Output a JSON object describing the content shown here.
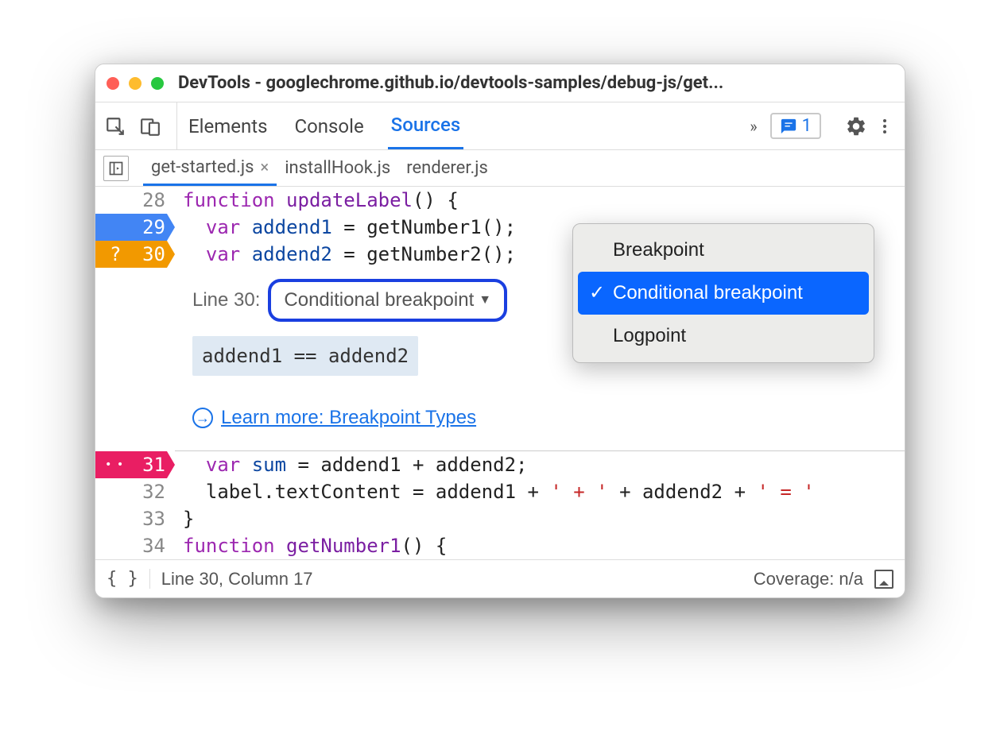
{
  "window_title": "DevTools - googlechrome.github.io/devtools-samples/debug-js/get...",
  "toolbar_tabs": {
    "elements": "Elements",
    "console": "Console",
    "sources": "Sources"
  },
  "issues_count": "1",
  "file_tabs": {
    "active": "get-started.js",
    "second": "installHook.js",
    "third": "renderer.js"
  },
  "code": {
    "l28_num": "28",
    "l28": {
      "kw": "function",
      "fn": " updateLabel",
      "rest": "() {"
    },
    "l29_num": "29",
    "l29": {
      "indent": "  ",
      "kw": "var",
      "id": " addend1",
      "rest": " = getNumber1();"
    },
    "l30_num": "30",
    "l30": {
      "indent": "  ",
      "kw": "var",
      "id": " addend2",
      "rest": " = getNumber2();"
    },
    "l31_num": "31",
    "l31": {
      "indent": "  ",
      "kw": "var",
      "id": " sum",
      "rest": " = addend1 + addend2;"
    },
    "l32_num": "32",
    "l32": {
      "indent": "  label.textContent = addend1 + ",
      "s1": "' + '",
      "mid": " + addend2 + ",
      "s2": "' = '"
    },
    "l33_num": "33",
    "l33": "}",
    "l34_num": "34",
    "l34": {
      "kw": "function",
      "fn": " getNumber1",
      "rest": "() {"
    }
  },
  "bp_editor": {
    "line_label": "Line 30:",
    "select_label": "Conditional breakpoint",
    "condition": "addend1 == addend2",
    "learn_more": "Learn more: Breakpoint Types"
  },
  "dropdown": {
    "opt1": "Breakpoint",
    "opt2": "Conditional breakpoint",
    "opt3": "Logpoint"
  },
  "statusbar": {
    "format": "{ }",
    "position": "Line 30, Column 17",
    "coverage": "Coverage: n/a"
  }
}
